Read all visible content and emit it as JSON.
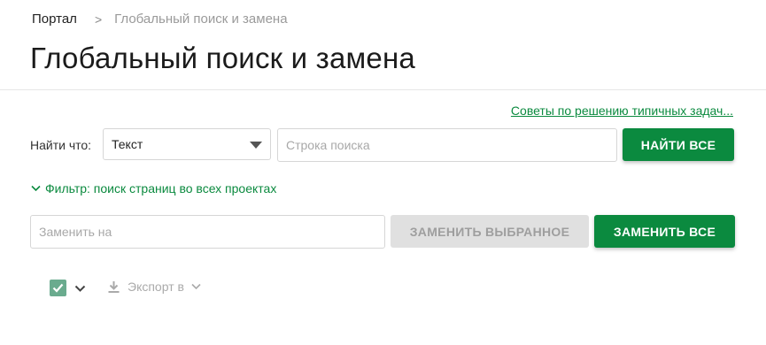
{
  "breadcrumb": {
    "home": "Портал",
    "separator": ">",
    "current": "Глобальный поиск и замена"
  },
  "page_title": "Глобальный поиск и замена",
  "tips_link": "Советы по решению типичных задач...",
  "find": {
    "label": "Найти что:",
    "type_selected": "Текст",
    "search_placeholder": "Строка поиска",
    "find_all_button": "НАЙТИ ВСЕ"
  },
  "filter_label": "Фильтр: поиск страниц во всех проектах",
  "replace": {
    "placeholder": "Заменить на",
    "replace_selected_button": "ЗАМЕНИТЬ ВЫБРАННОЕ",
    "replace_all_button": "ЗАМЕНИТЬ ВСЕ"
  },
  "export_label": "Экспорт в",
  "colors": {
    "accent_green": "#0b8a3f",
    "checkbox_green": "#6aab8e",
    "disabled_bg": "#e0e0e0"
  },
  "icons": [
    "chevron-right-icon",
    "caret-down-icon",
    "chevron-down-icon",
    "checkmark-icon",
    "download-icon"
  ]
}
